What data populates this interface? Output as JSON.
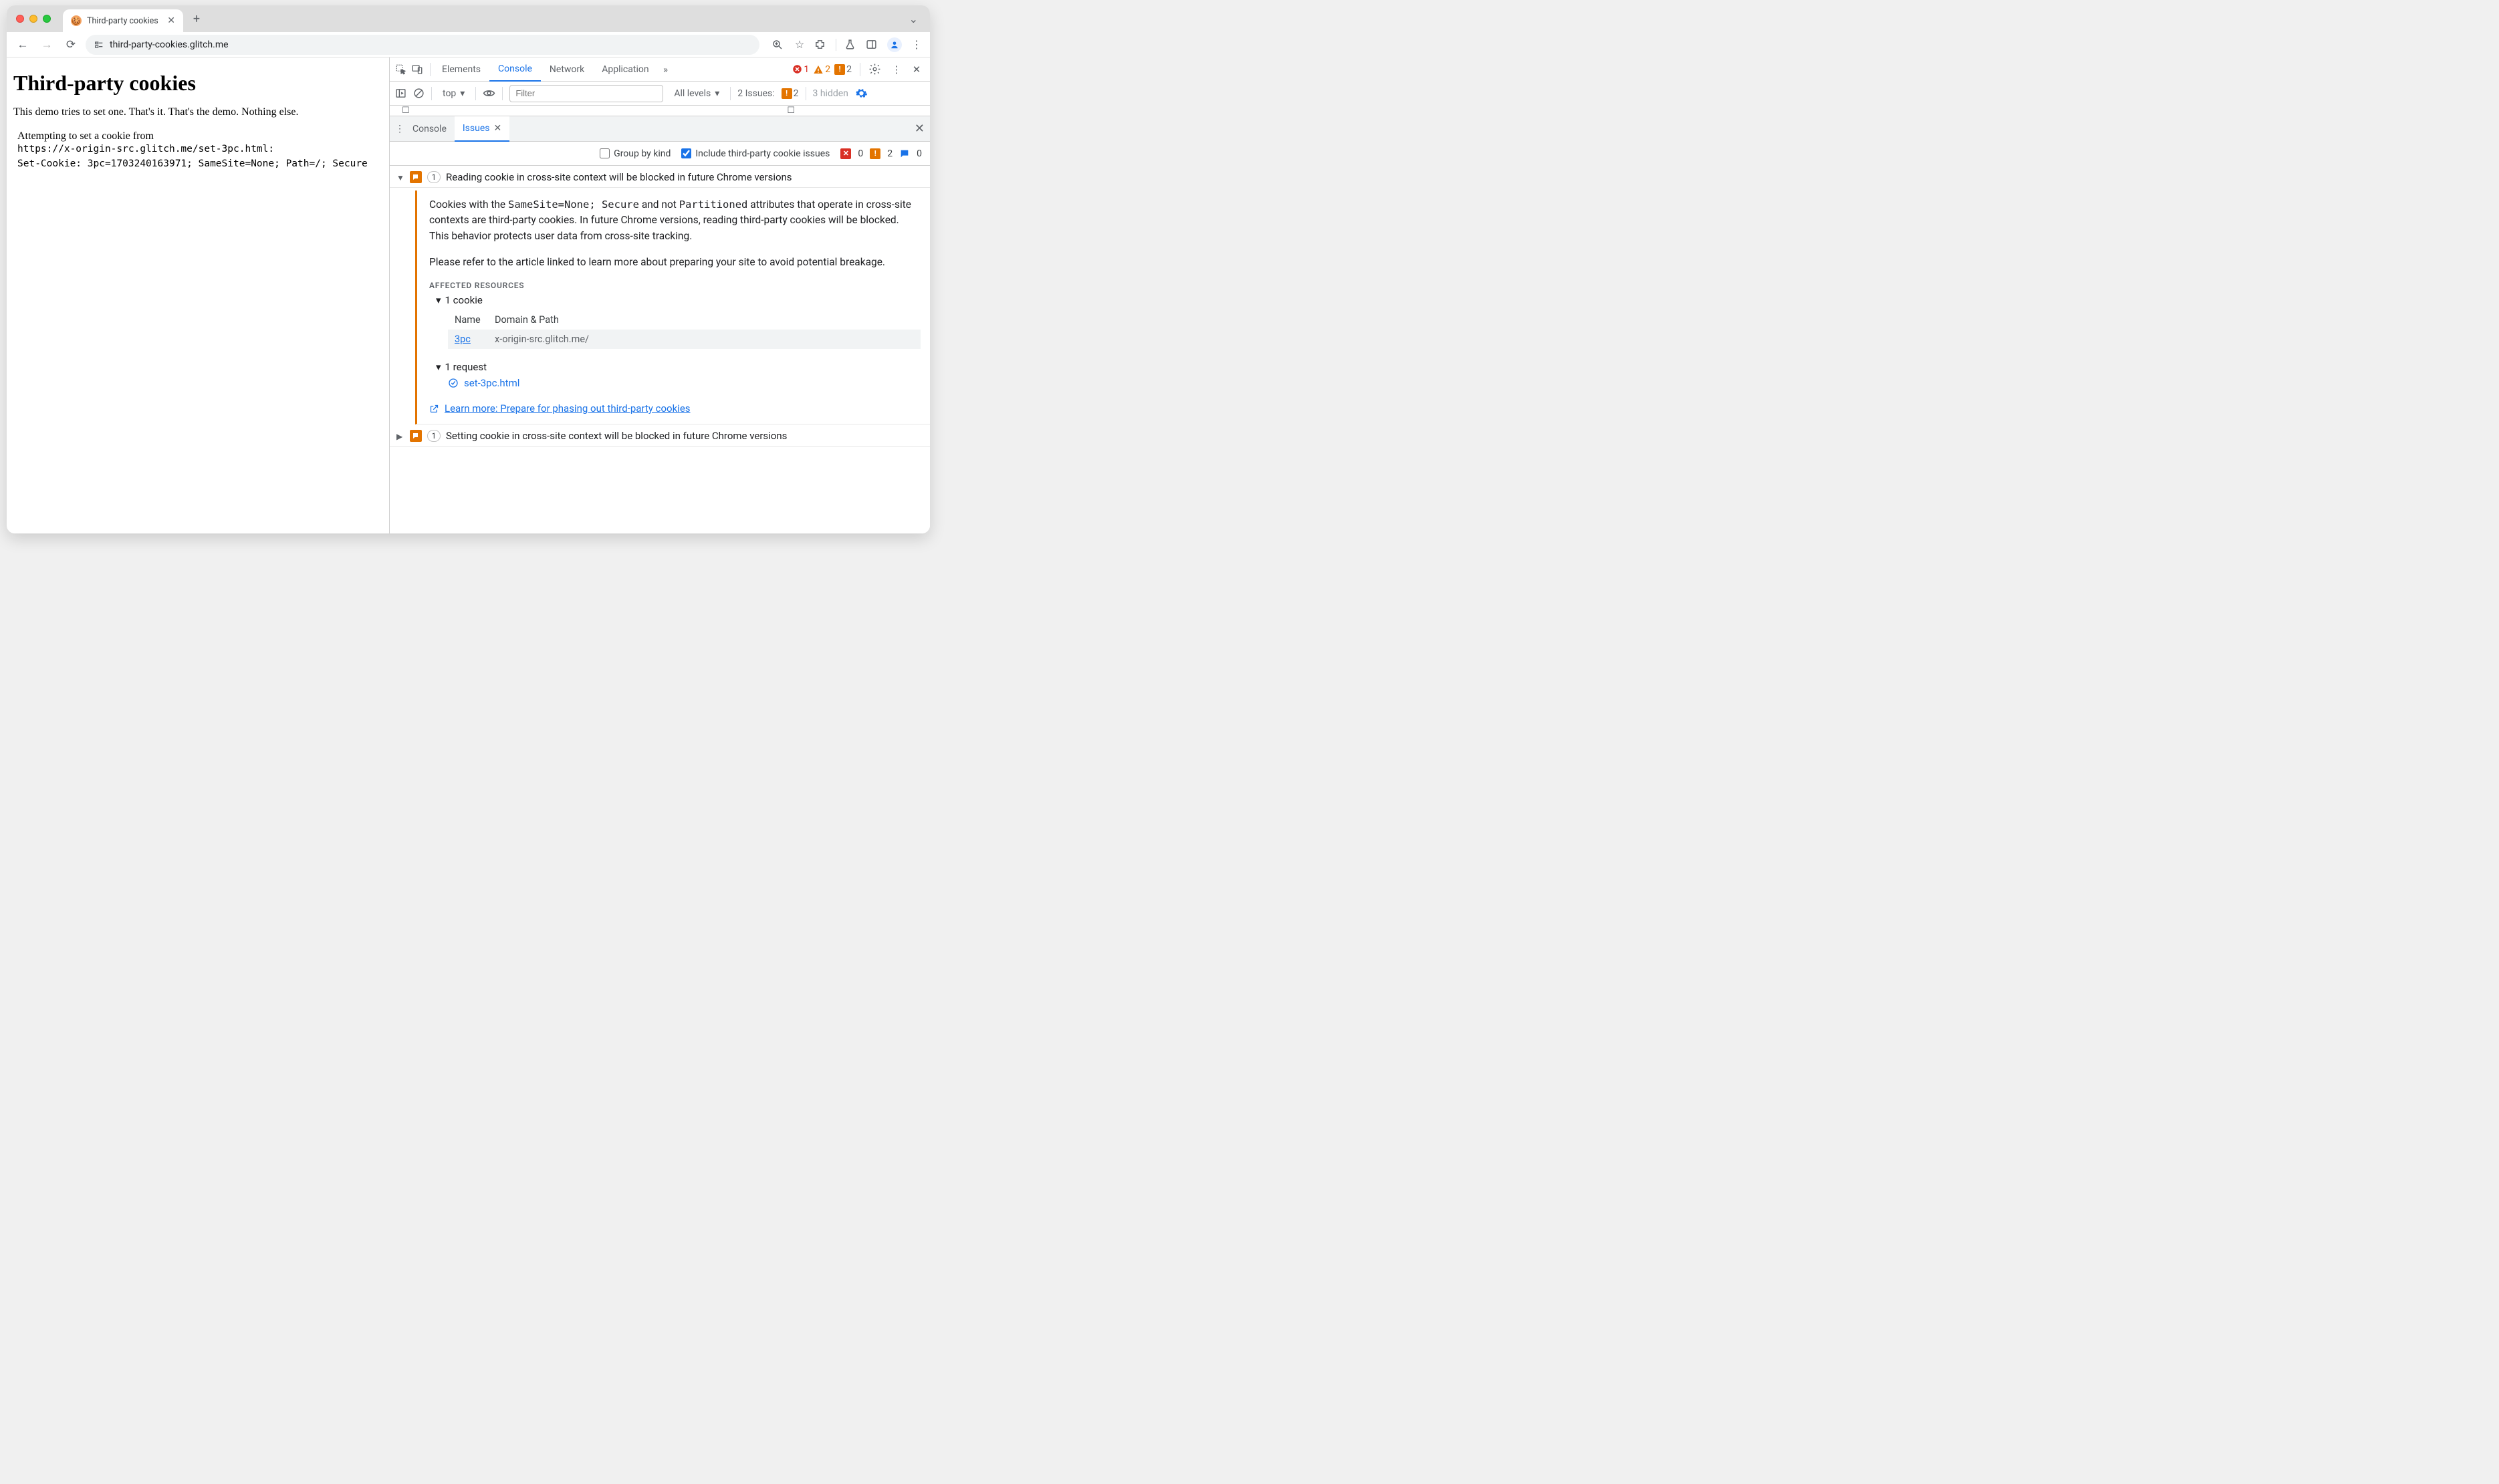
{
  "window": {
    "tab_title": "Third-party cookies",
    "url": "third-party-cookies.glitch.me"
  },
  "page": {
    "heading": "Third-party cookies",
    "intro": "This demo tries to set one. That's it. That's the demo. Nothing else.",
    "attempt_line1": "Attempting to set a cookie from",
    "attempt_line2": "https://x-origin-src.glitch.me/set-3pc.html:",
    "attempt_line3": "Set-Cookie: 3pc=1703240163971; SameSite=None; Path=/; Secure"
  },
  "devtools": {
    "tabs": {
      "elements": "Elements",
      "console": "Console",
      "network": "Network",
      "application": "Application"
    },
    "counts": {
      "errors": "1",
      "warnings": "2",
      "issues": "2",
      "hidden": "3 hidden"
    },
    "console_toolbar": {
      "context": "top",
      "filter_placeholder": "Filter",
      "levels": "All levels",
      "issues_label": "2 Issues:",
      "issues_badge": "2"
    },
    "drawer": {
      "console": "Console",
      "issues": "Issues"
    },
    "issues_toolbar": {
      "group_by_kind": "Group by kind",
      "include_3p": "Include third-party cookie issues",
      "err_count": "0",
      "warn_count": "2",
      "info_count": "0"
    },
    "issues": [
      {
        "count": "1",
        "title": "Reading cookie in cross-site context will be blocked in future Chrome versions",
        "expanded": true,
        "p1a": "Cookies with the ",
        "p1b": "SameSite=None; Secure",
        "p1c": " and not ",
        "p1d": "Partitioned",
        "p1e": " attributes that operate in cross-site contexts are third-party cookies. In future Chrome versions, reading third-party cookies will be blocked. This behavior protects user data from cross-site tracking.",
        "p2": "Please refer to the article linked to learn more about preparing your site to avoid potential breakage.",
        "affected_label": "AFFECTED RESOURCES",
        "cookie_header": "1 cookie",
        "cookie_col1": "Name",
        "cookie_col2": "Domain & Path",
        "cookie_name": "3pc",
        "cookie_domain": "x-origin-src.glitch.me/",
        "request_header": "1 request",
        "request_name": "set-3pc.html",
        "learn_more": "Learn more: Prepare for phasing out third-party cookies"
      },
      {
        "count": "1",
        "title": "Setting cookie in cross-site context will be blocked in future Chrome versions",
        "expanded": false
      }
    ]
  }
}
